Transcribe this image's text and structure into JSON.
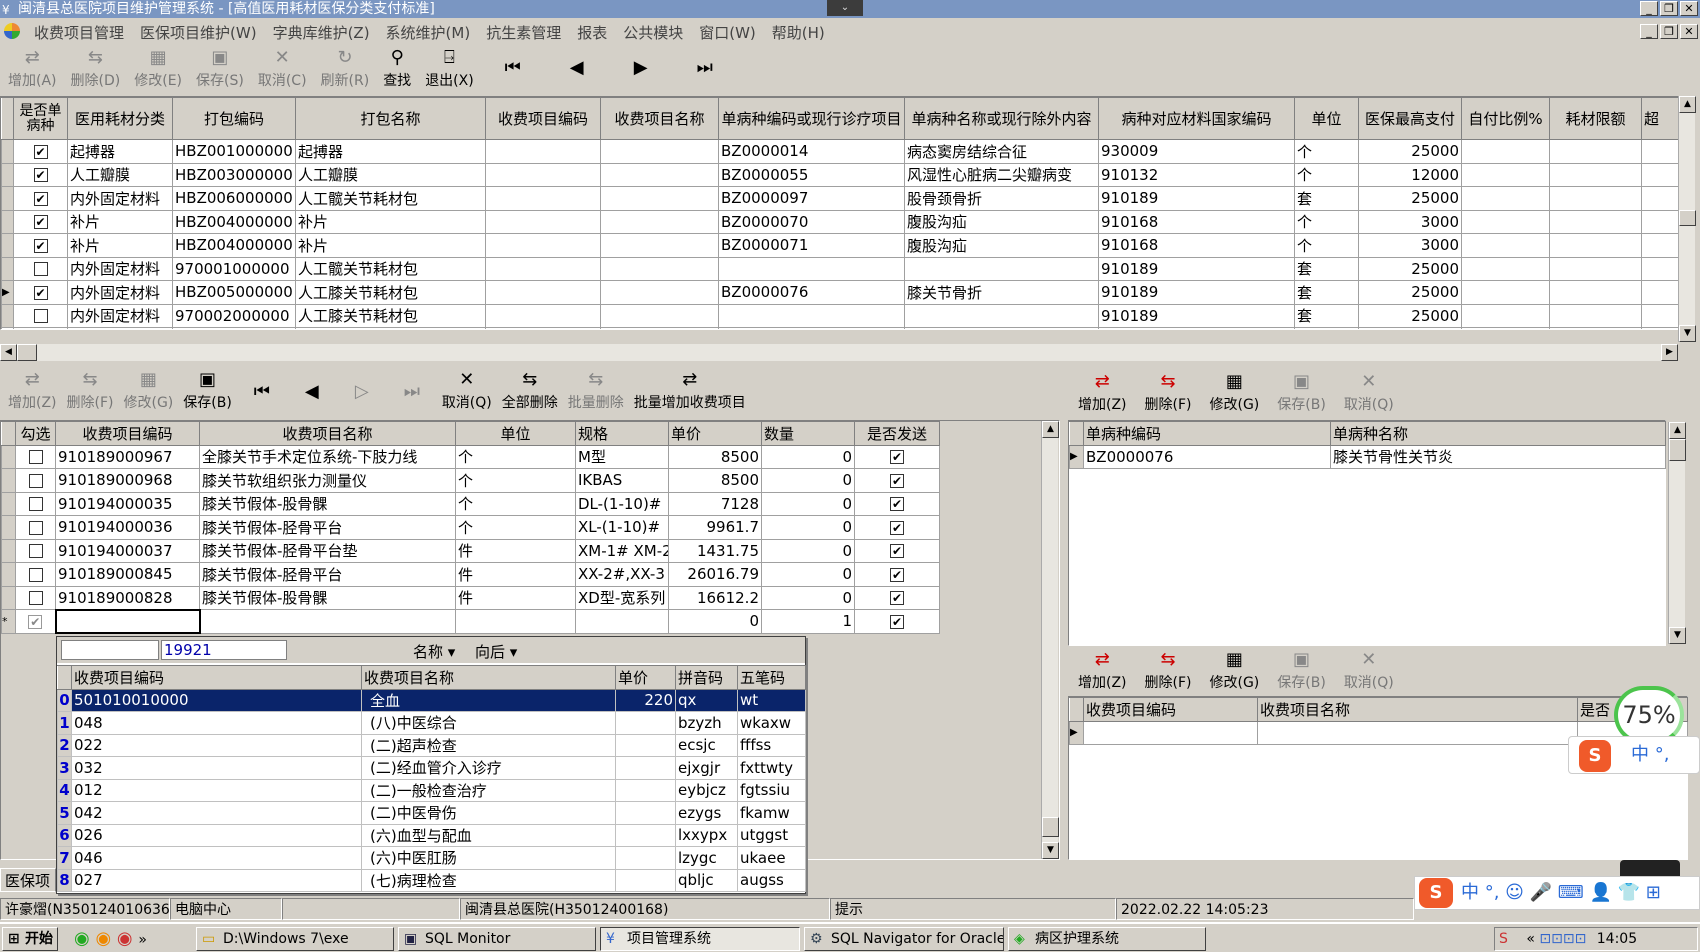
{
  "window": {
    "title": "闽清县总医院项目维护管理系统 - [高值医用耗材医保分类支付标准]"
  },
  "menu": [
    "收费项目管理",
    "医保项目维护(W)",
    "字典库维护(Z)",
    "系统维护(M)",
    "抗生素管理",
    "报表",
    "公共模块",
    "窗口(W)",
    "帮助(H)"
  ],
  "toolbar": {
    "add": "增加(A)",
    "delete": "删除(D)",
    "modify": "修改(E)",
    "save": "保存(S)",
    "cancel": "取消(C)",
    "refresh": "刷新(R)",
    "find": "查找",
    "exit": "退出(X)"
  },
  "main_grid": {
    "headers": [
      "是否单病种",
      "医用耗材分类",
      "打包编码",
      "打包名称",
      "收费项目编码",
      "收费项目名称",
      "单病种编码或现行诊疗项目",
      "单病种名称或现行除外内容",
      "病种对应材料国家编码",
      "单位",
      "医保最高支付",
      "自付比例%",
      "耗材限额",
      "超"
    ],
    "rows": [
      {
        "checked": true,
        "cat": "起搏器",
        "code": "HBZ001000000",
        "name": "起搏器",
        "dz": "BZ0000014",
        "dzname": "病态窦房结综合征",
        "nat": "930009",
        "unit": "个",
        "max": "25000"
      },
      {
        "checked": true,
        "cat": "人工瓣膜",
        "code": "HBZ003000000",
        "name": "人工瓣膜",
        "dz": "BZ0000055",
        "dzname": "风湿性心脏病二尖瓣病变",
        "nat": "910132",
        "unit": "个",
        "max": "12000"
      },
      {
        "checked": true,
        "cat": "内外固定材料",
        "code": "HBZ006000000",
        "name": "人工髋关节耗材包",
        "dz": "BZ0000097",
        "dzname": "股骨颈骨折",
        "nat": "910189",
        "unit": "套",
        "max": "25000"
      },
      {
        "checked": true,
        "cat": "补片",
        "code": "HBZ004000000",
        "name": "补片",
        "dz": "BZ0000070",
        "dzname": "腹股沟疝",
        "nat": "910168",
        "unit": "个",
        "max": "3000"
      },
      {
        "checked": true,
        "cat": "补片",
        "code": "HBZ004000000",
        "name": "补片",
        "dz": "BZ0000071",
        "dzname": "腹股沟疝",
        "nat": "910168",
        "unit": "个",
        "max": "3000"
      },
      {
        "checked": false,
        "cat": "内外固定材料",
        "code": "970001000000",
        "name": "人工髋关节耗材包",
        "dz": "",
        "dzname": "",
        "nat": "910189",
        "unit": "套",
        "max": "25000"
      },
      {
        "checked": true,
        "cat": "内外固定材料",
        "code": "HBZ005000000",
        "name": "人工膝关节耗材包",
        "dz": "BZ0000076",
        "dzname": "膝关节骨折",
        "nat": "910189",
        "unit": "套",
        "max": "25000"
      },
      {
        "checked": false,
        "cat": "内外固定材料",
        "code": "970002000000",
        "name": "人工膝关节耗材包",
        "dz": "",
        "dzname": "",
        "nat": "910189",
        "unit": "套",
        "max": "25000"
      }
    ]
  },
  "sub_toolbar": {
    "add": "增加(Z)",
    "delete": "删除(F)",
    "modify": "修改(G)",
    "save": "保存(B)",
    "cancel": "取消(Q)",
    "delete_all": "全部删除",
    "batch_delete": "批量删除",
    "batch_add": "批量增加收费项目"
  },
  "items_grid": {
    "headers": [
      "勾选",
      "收费项目编码",
      "收费项目名称",
      "单位",
      "规格",
      "单价",
      "数量",
      "是否发送"
    ],
    "rows": [
      {
        "code": "910189000967",
        "name": "全膝关节手术定位系统-下肢力线",
        "unit": "个",
        "spec": "M型",
        "price": "8500",
        "qty": "0"
      },
      {
        "code": "910189000968",
        "name": "膝关节软组织张力测量仪",
        "unit": "个",
        "spec": "IKBAS",
        "price": "8500",
        "qty": "0"
      },
      {
        "code": "910194000035",
        "name": "膝关节假体-股骨髁",
        "unit": "个",
        "spec": "DL-(1-10)#",
        "price": "7128",
        "qty": "0"
      },
      {
        "code": "910194000036",
        "name": "膝关节假体-胫骨平台",
        "unit": "个",
        "spec": "XL-(1-10)#",
        "price": "9961.7",
        "qty": "0"
      },
      {
        "code": "910194000037",
        "name": "膝关节假体-胫骨平台垫",
        "unit": "件",
        "spec": "XM-1# XM-2",
        "price": "1431.75",
        "qty": "0"
      },
      {
        "code": "910189000845",
        "name": "膝关节假体-胫骨平台",
        "unit": "件",
        "spec": "XX-2#,XX-3",
        "price": "26016.79",
        "qty": "0"
      },
      {
        "code": "910189000828",
        "name": "膝关节假体-股骨髁",
        "unit": "件",
        "spec": "XD型-宽系列",
        "price": "16612.2",
        "qty": "0"
      }
    ],
    "new_row": {
      "price": "0",
      "qty": "1"
    }
  },
  "popup": {
    "search_value": "19921",
    "field": "名称",
    "direction": "向后",
    "headers": [
      "收费项目编码",
      "收费项目名称",
      "单价",
      "拼音码",
      "五笔码"
    ],
    "rows": [
      {
        "i": "0",
        "code": "501010010000",
        "name": "全血",
        "price": "220",
        "py": "qx",
        "wb": "wt"
      },
      {
        "i": "1",
        "code": "048",
        "name": "(八)中医综合",
        "price": "",
        "py": "bzyzh",
        "wb": "wkaxw"
      },
      {
        "i": "2",
        "code": "022",
        "name": "(二)超声检查",
        "price": "",
        "py": "ecsjc",
        "wb": "fffss"
      },
      {
        "i": "3",
        "code": "032",
        "name": "(二)经血管介入诊疗",
        "price": "",
        "py": "ejxgjr",
        "wb": "fxttwty"
      },
      {
        "i": "4",
        "code": "012",
        "name": "(二)一般检查治疗",
        "price": "",
        "py": "eybjcz",
        "wb": "fgtssiu"
      },
      {
        "i": "5",
        "code": "042",
        "name": "(二)中医骨伤",
        "price": "",
        "py": "ezygs",
        "wb": "fkamw"
      },
      {
        "i": "6",
        "code": "026",
        "name": "(六)血型与配血",
        "price": "",
        "py": "lxxypx",
        "wb": "utggst"
      },
      {
        "i": "7",
        "code": "046",
        "name": "(六)中医肛肠",
        "price": "",
        "py": "lzygc",
        "wb": "ukaee"
      },
      {
        "i": "8",
        "code": "027",
        "name": "(七)病理检查",
        "price": "",
        "py": "qbljc",
        "wb": "augss"
      }
    ]
  },
  "right_toolbar": {
    "add": "增加(Z)",
    "delete": "删除(F)",
    "modify": "修改(G)",
    "save": "保存(B)",
    "cancel": "取消(Q)"
  },
  "disease_grid": {
    "headers": [
      "单病种编码",
      "单病种名称"
    ],
    "rows": [
      {
        "code": "BZ0000076",
        "name": "膝关节骨性关节炎"
      }
    ]
  },
  "fee_grid": {
    "headers": [
      "收费项目编码",
      "收费项目名称",
      "是否"
    ]
  },
  "left_tab": "医保项",
  "badge": {
    "percent": "75%"
  },
  "ime": {
    "lang": "中"
  },
  "status": {
    "user": "许豪熠(N350124010636)",
    "dept": "电脑中心",
    "hospital": "闽清县总医院(H35012400168)",
    "hint": "提示",
    "datetime": "2022.02.22 14:05:23"
  },
  "taskbar": {
    "start": "开始",
    "tasks": [
      "D:\\Windows 7\\exe",
      "SQL Monitor",
      "项目管理系统",
      "SQL Navigator for Oracle",
      "病区护理系统"
    ],
    "clock": "14:05"
  }
}
